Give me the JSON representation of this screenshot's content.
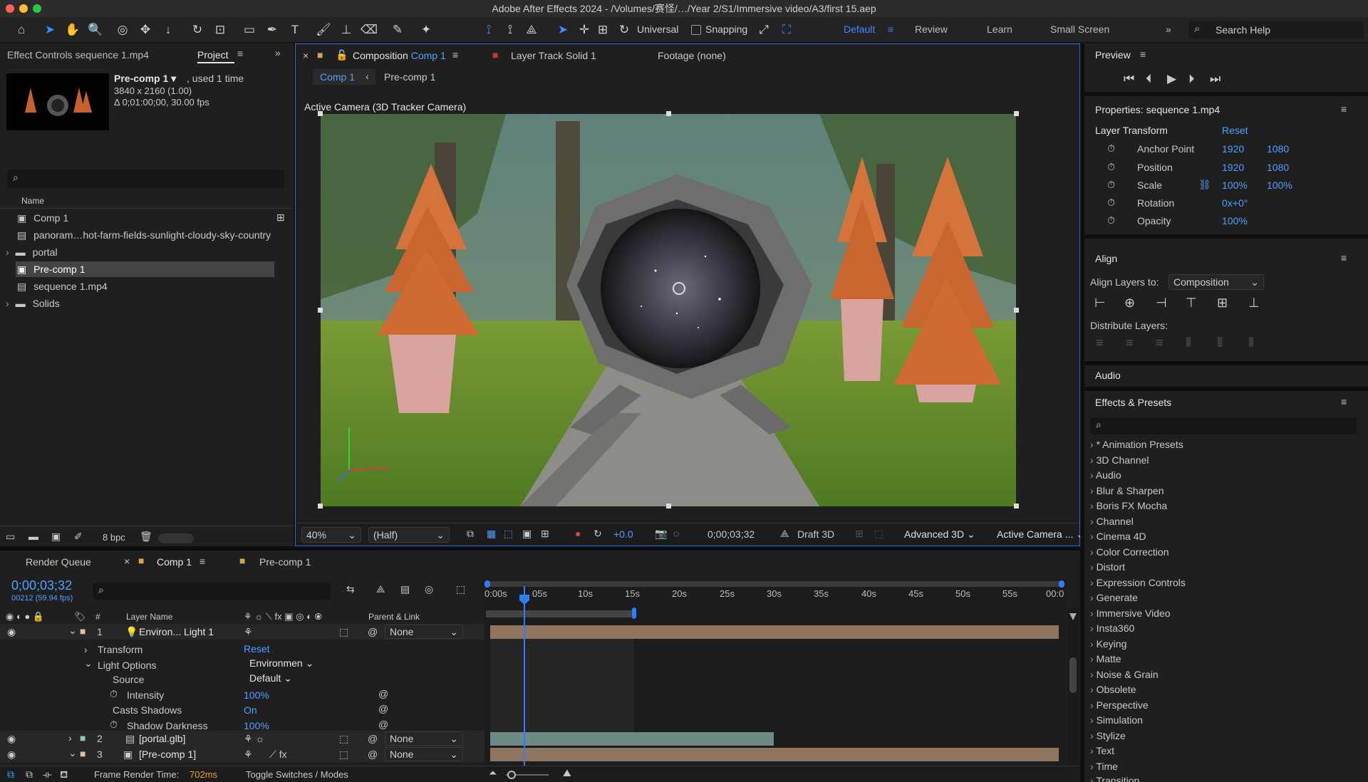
{
  "window": {
    "title": "Adobe After Effects 2024 - /Volumes/赛怪/…/Year 2/S1/Immersive video/A3/first 15.aep"
  },
  "toolbar": {
    "universal": "Universal",
    "snapping": "Snapping",
    "workspaces": [
      "Default",
      "Review",
      "Learn",
      "Small Screen"
    ],
    "search_help": "Search Help"
  },
  "left": {
    "tab_effect": "Effect Controls sequence 1.mp4",
    "tab_project": "Project",
    "selected_name": "Pre-comp 1 ▾",
    "used": ", used 1 time",
    "resolution": "3840 x 2160 (1.00)",
    "duration": "Δ 0;01:00;00, 30.00 fps",
    "col_name": "Name",
    "items": [
      {
        "label": "Comp 1",
        "type": "comp"
      },
      {
        "label": "panoram…hot-farm-fields-sunlight-cloudy-sky-country",
        "type": "file"
      },
      {
        "label": "portal",
        "type": "folder"
      },
      {
        "label": "Pre-comp 1",
        "type": "comp"
      },
      {
        "label": "sequence 1.mp4",
        "type": "file"
      },
      {
        "label": "Solids",
        "type": "folder"
      }
    ],
    "bpc": "8 bpc"
  },
  "viewer": {
    "tab_comp_prefix": "Composition",
    "tab_comp_name": "Comp 1",
    "tab_layer": "Layer Track Solid 1",
    "tab_footage": "Footage (none)",
    "crumb1": "Comp 1",
    "crumb2": "Pre-comp 1",
    "camera_label": "Active Camera (3D Tracker Camera)",
    "zoom": "40%",
    "quality": "(Half)",
    "exposure": "+0.0",
    "timecode": "0;00;03;32",
    "draft": "Draft 3D",
    "renderer": "Advanced 3D",
    "view": "Active Camera ..."
  },
  "right": {
    "preview": "Preview",
    "properties": "Properties: sequence 1.mp4",
    "layer_transform": "Layer Transform",
    "reset": "Reset",
    "props": [
      {
        "label": "Anchor Point",
        "v1": "1920",
        "v2": "1080"
      },
      {
        "label": "Position",
        "v1": "1920",
        "v2": "1080"
      },
      {
        "label": "Scale",
        "v1": "100%",
        "v2": "100%"
      },
      {
        "label": "Rotation",
        "v1": "0x+0°",
        "v2": ""
      },
      {
        "label": "Opacity",
        "v1": "100%",
        "v2": ""
      }
    ],
    "align": "Align",
    "align_to_label": "Align Layers to:",
    "align_to_value": "Composition",
    "distribute": "Distribute Layers:",
    "audio": "Audio",
    "effects": "Effects & Presets",
    "effects_list": [
      "* Animation Presets",
      "3D Channel",
      "Audio",
      "Blur & Sharpen",
      "Boris FX Mocha",
      "Channel",
      "Cinema 4D",
      "Color Correction",
      "Distort",
      "Expression Controls",
      "Generate",
      "Immersive Video",
      "Insta360",
      "Keying",
      "Matte",
      "Noise & Grain",
      "Obsolete",
      "Perspective",
      "Simulation",
      "Stylize",
      "Text",
      "Time",
      "Transition"
    ]
  },
  "timeline": {
    "tab_render": "Render Queue",
    "tab_comp1": "Comp 1",
    "tab_precomp": "Pre-comp 1",
    "timecode": "0;00;03;32",
    "fps": "00212 (59.94 fps)",
    "col_layer": "Layer Name",
    "col_parent": "Parent & Link",
    "col_num": "#",
    "ticks": [
      "0:00s",
      "05s",
      "10s",
      "15s",
      "20s",
      "25s",
      "30s",
      "35s",
      "40s",
      "45s",
      "50s",
      "55s",
      "00:0"
    ],
    "layer1": {
      "num": "1",
      "name": "Environ... Light 1",
      "parent": "None"
    },
    "transform": "Transform",
    "reset": "Reset",
    "light_options": "Light Options",
    "light_type": "Environmen",
    "source": "Source",
    "source_val": "Default",
    "intensity": "Intensity",
    "intensity_val": "100%",
    "casts": "Casts Shadows",
    "casts_val": "On",
    "shadow": "Shadow Darkness",
    "shadow_val": "100%",
    "layer2": {
      "num": "2",
      "name": "[portal.glb]",
      "parent": "None"
    },
    "layer3": {
      "num": "3",
      "name": "[Pre-comp 1]",
      "parent": "None"
    },
    "frame_render_label": "Frame Render Time:",
    "frame_render_val": "702ms",
    "toggle": "Toggle Switches / Modes"
  },
  "colors": {
    "accent": "#3a8bff",
    "orange": "#e8a33d"
  }
}
